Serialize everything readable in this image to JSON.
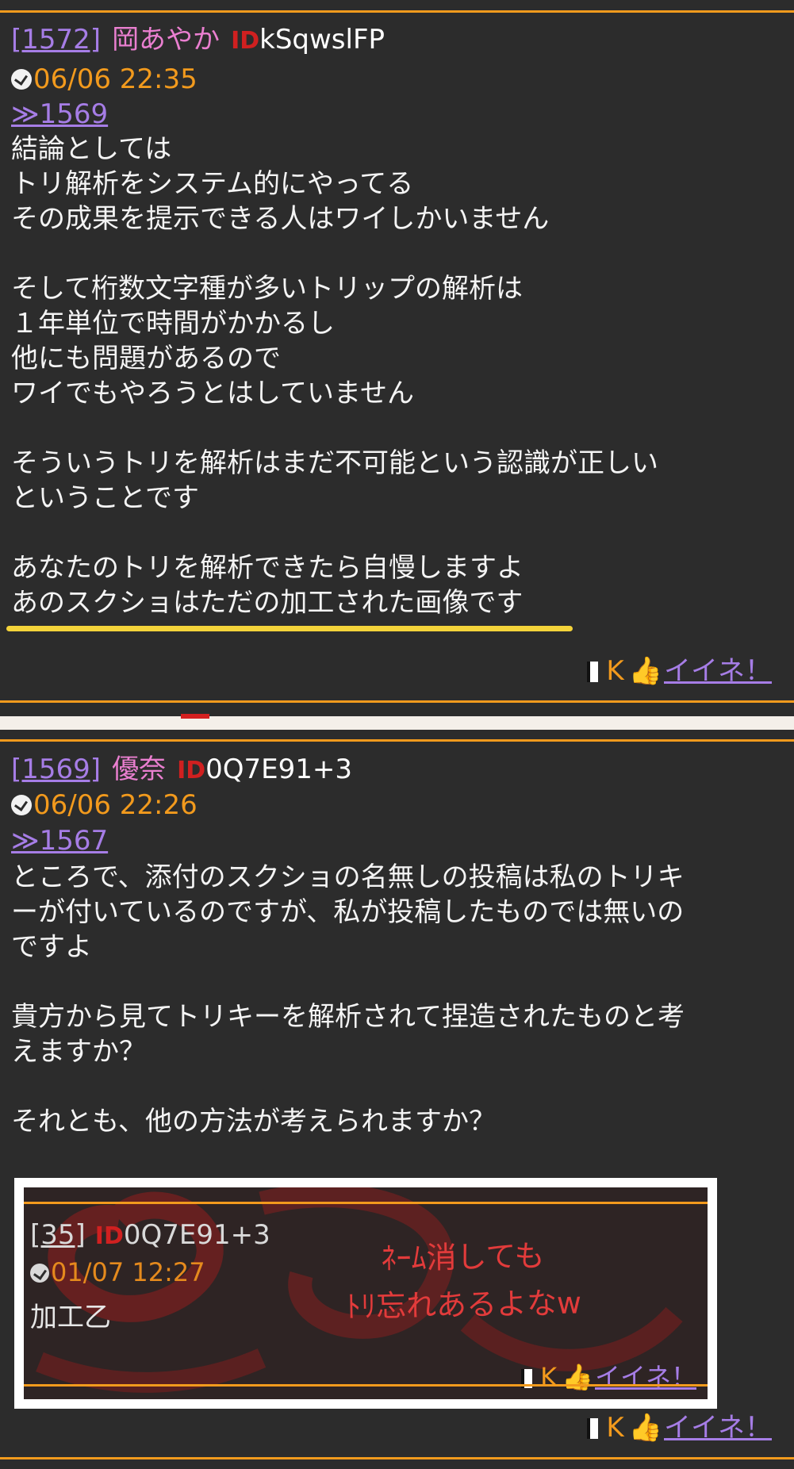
{
  "post1": {
    "res_num": "[1572]",
    "name": "岡あやか",
    "trip_icon": "ID",
    "trip": "kSqwslFP",
    "datetime": "06/06 22:35",
    "anchor": "≫1569",
    "body": "結論としては\nトリ解析をシステム的にやってる\nその成果を提示できる人はワイしかいません\n\nそして桁数文字種が多いトリップの解析は\n１年単位で時間がかかるし\n他にも問題があるので\nワイでもやろうとはしていません\n\nそういうトリを解析はまだ不可能という認識が正しい\nということです\n\nあなたのトリを解析できたら自慢しますよ\nあのスクショはただの加工された画像です",
    "footer_k": "K",
    "footer_like": "イイネ！"
  },
  "post2": {
    "res_num": "[1569]",
    "name": "優奈",
    "trip_icon": "ID",
    "trip": "0Q7E91+3",
    "datetime": "06/06 22:26",
    "anchor": "≫1567",
    "body": "ところで、添付のスクショの名無しの投稿は私のトリキ\nーが付いているのですが、私が投稿したものでは無いの\nですよ\n\n貴方から見てトリキーを解析されて捏造されたものと考\nえますか？\n\nそれとも、他の方法が考えられますか？",
    "footer_k": "K",
    "footer_like": "イイネ！",
    "attachment": {
      "res_num": "[35]",
      "trip_icon": "ID",
      "trip": "0Q7E91+3",
      "datetime": "01/07 12:27",
      "body": "加工乙",
      "overlay_line1": "ﾈｰﾑ消しても",
      "overlay_line2": "ﾄﾘ忘れあるよなw",
      "footer_k": "K",
      "footer_like": "イイネ！"
    }
  },
  "colors": {
    "background": "#2c2c2c",
    "accent_orange": "#f29a1d",
    "link_purple": "#a67de6",
    "name_pink": "#ea7fd0",
    "underline_yellow": "#f4d33a",
    "trip_red": "#d02020"
  },
  "icons": [
    "clock-icon",
    "trip-id-icon",
    "mobile-phone-icon",
    "thumbs-up-icon"
  ]
}
